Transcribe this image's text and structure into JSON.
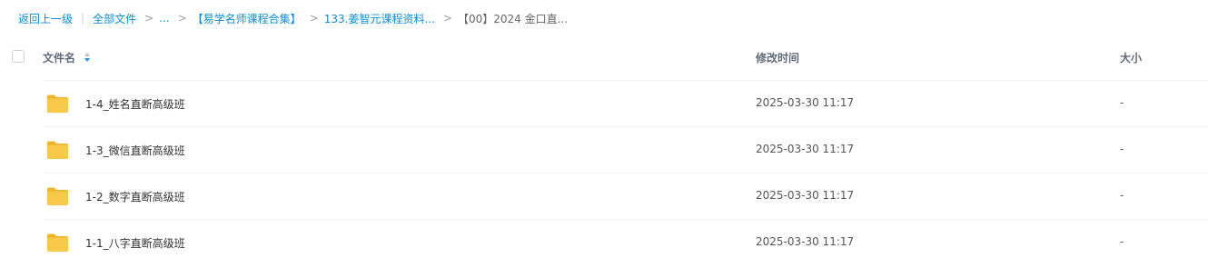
{
  "breadcrumb": {
    "back": "返回上一级",
    "separator_bar": "|",
    "all_files": "全部文件",
    "sep": ">",
    "ellipsis": "...",
    "folder1": "【易学名师课程合集】",
    "folder2": "133.姜智元课程资料...",
    "current": "【00】2024 金口直..."
  },
  "table": {
    "columns": {
      "name": "文件名",
      "modified": "修改时间",
      "size": "大小"
    },
    "rows": [
      {
        "name": "1-4_姓名直断高级班",
        "modified": "2025-03-30 11:17",
        "size": "-",
        "icon": "folder-icon"
      },
      {
        "name": "1-3_微信直断高级班",
        "modified": "2025-03-30 11:17",
        "size": "-",
        "icon": "folder-icon"
      },
      {
        "name": "1-2_数字直断高级班",
        "modified": "2025-03-30 11:17",
        "size": "-",
        "icon": "folder-icon"
      },
      {
        "name": "1-1_八字直断高级班",
        "modified": "2025-03-30 11:17",
        "size": "-",
        "icon": "folder-icon"
      }
    ]
  },
  "colors": {
    "link": "#0a8fd6",
    "folder": "#f7c948",
    "folder_dark": "#eeb42c",
    "sort_active": "#1b9af7"
  }
}
